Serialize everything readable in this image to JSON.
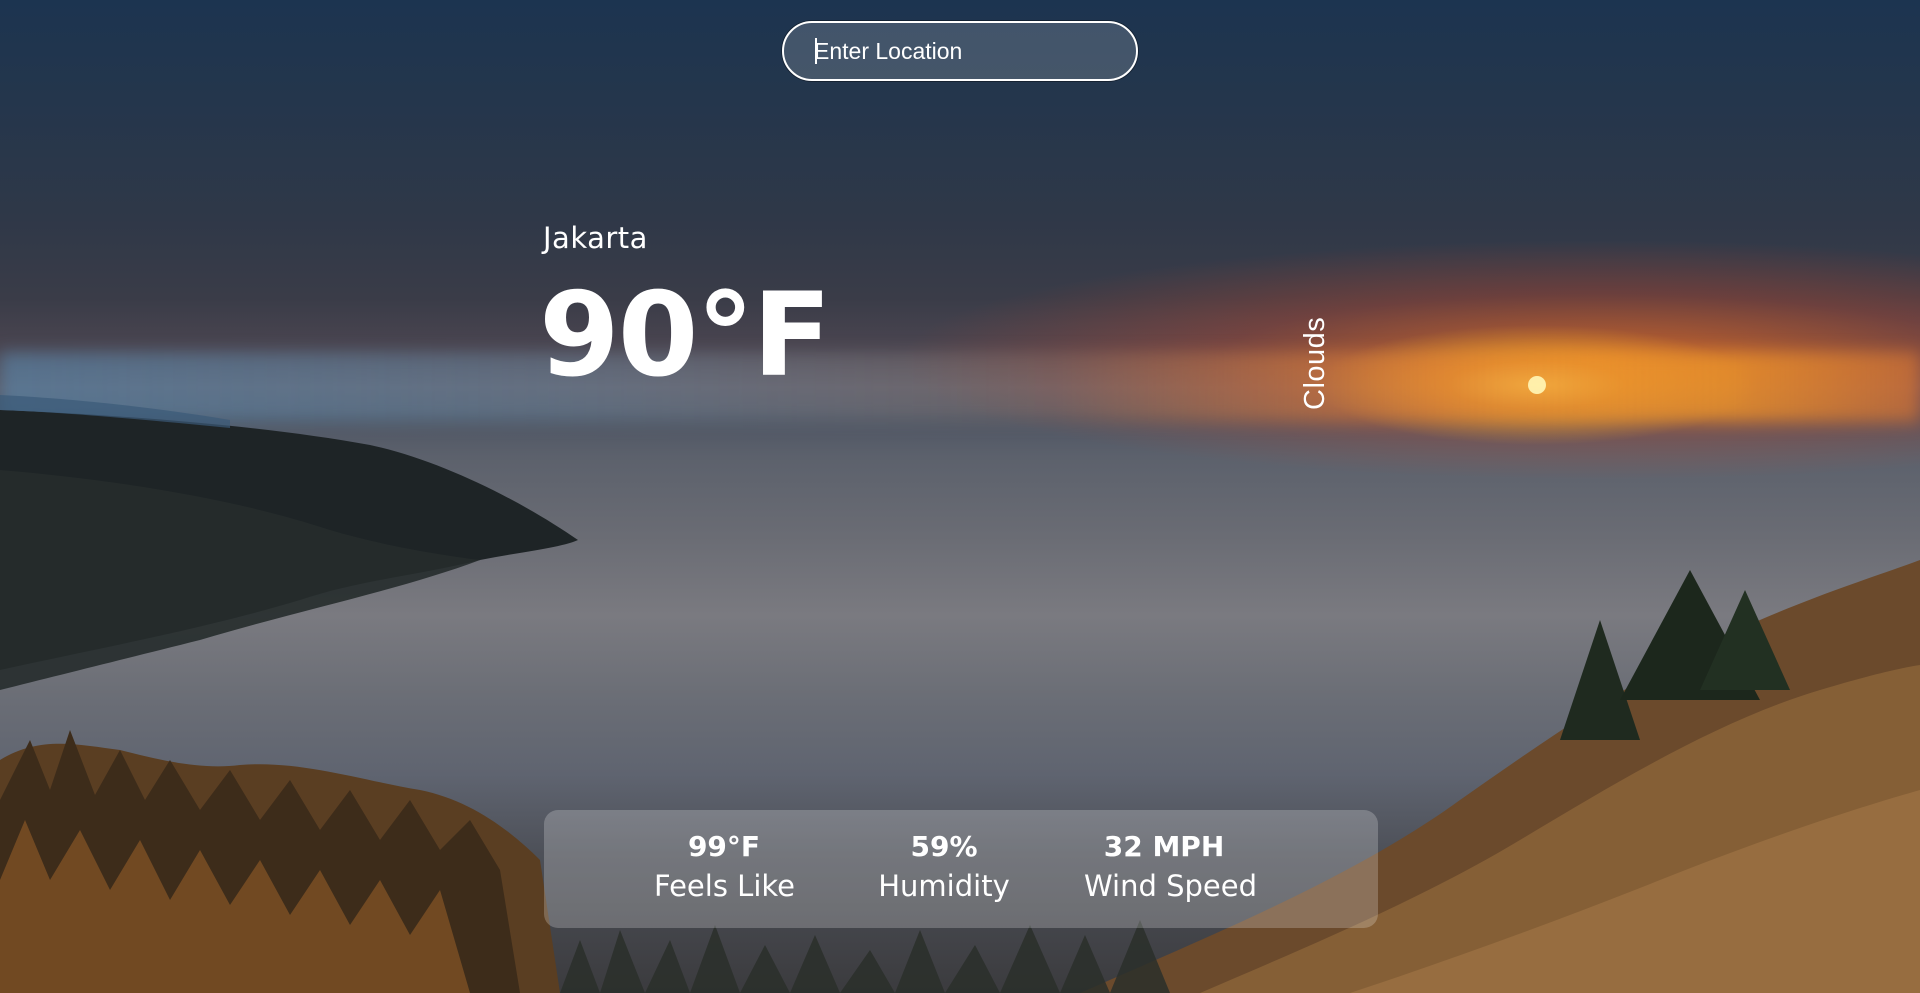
{
  "search": {
    "placeholder": "Enter Location",
    "value": ""
  },
  "weather": {
    "city": "Jakarta",
    "temperature": "90°F",
    "condition": "Clouds"
  },
  "stats": {
    "feels_like": {
      "value": "99°F",
      "label": "Feels Like"
    },
    "humidity": {
      "value": "59%",
      "label": "Humidity"
    },
    "wind_speed": {
      "value": "32 MPH",
      "label": "Wind Speed"
    }
  },
  "background": {
    "scene": "sunset over sea of clouds with forested hills"
  }
}
